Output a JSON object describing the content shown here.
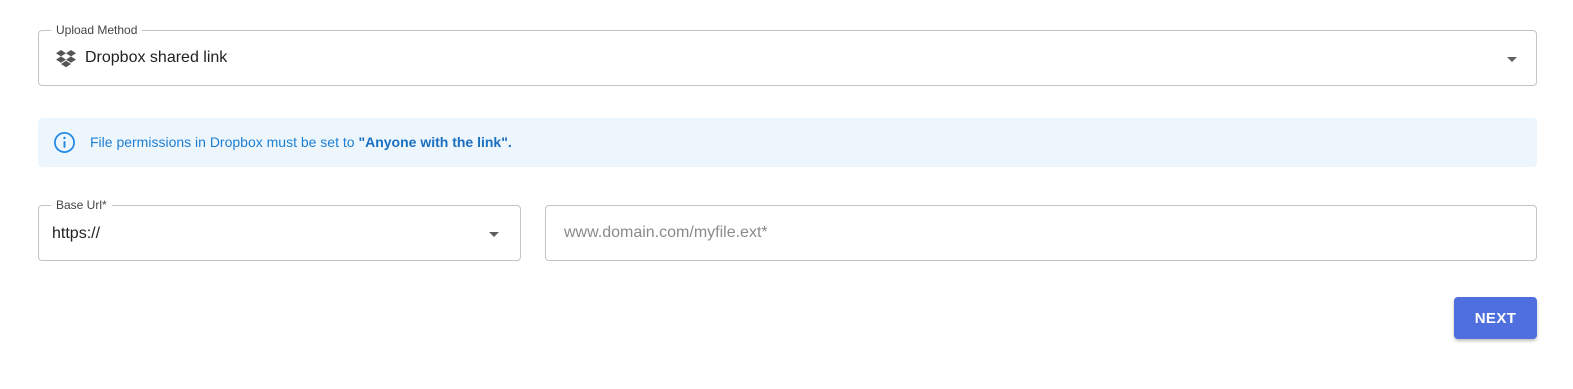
{
  "colors": {
    "primary": "#4f6fdf",
    "info_text": "#1e7fd2",
    "info_background": "#eef6fd",
    "field_border": "#c4c4c4"
  },
  "upload_method": {
    "label": "Upload Method",
    "value": "Dropbox shared link",
    "icon": "dropbox-icon"
  },
  "info_banner": {
    "icon": "info-icon",
    "text_prefix": "File permissions in Dropbox must be set to ",
    "text_emphasis": "\"Anyone with the link\"."
  },
  "base_url": {
    "label": "Base Url*",
    "value": "https://"
  },
  "url_input": {
    "value": "",
    "placeholder": "www.domain.com/myfile.ext*"
  },
  "actions": {
    "next_label": "NEXT"
  }
}
